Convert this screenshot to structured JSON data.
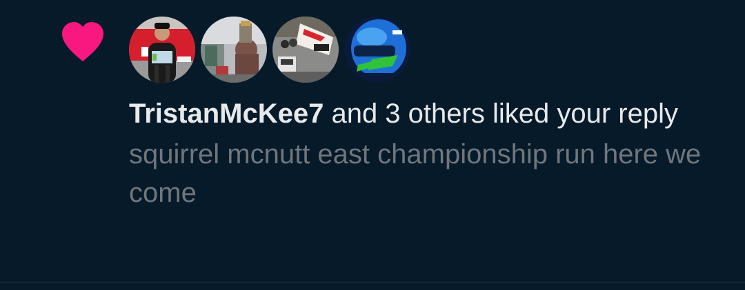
{
  "notification": {
    "type": "like",
    "user_name": "TristanMcKee7",
    "action_text": " and 3 others liked your reply",
    "reply_preview": "squirrel mcnutt east championship run here we come",
    "avatars": [
      {
        "user": "TristanMcKee7",
        "icon": "racing-driver-photo"
      },
      {
        "user": "other-1",
        "icon": "racing-crowd-photo"
      },
      {
        "user": "other-2",
        "icon": "race-car-photo"
      },
      {
        "user": "other-3",
        "icon": "racing-helmet-photo"
      }
    ]
  },
  "colors": {
    "background": "#061a2a",
    "heart": "#f91880",
    "primary_text": "#e7e9ea",
    "secondary_text": "#71767b",
    "divider": "#2a3844"
  }
}
